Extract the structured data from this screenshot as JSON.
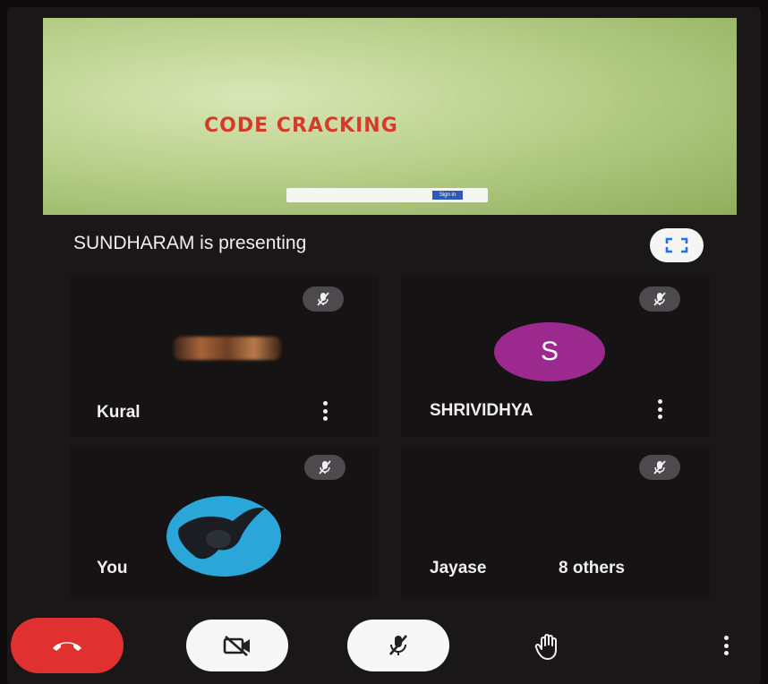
{
  "presentation": {
    "slide_title": "CODE CRACKING",
    "slide_button": "Sign in"
  },
  "presenting_label": "SUNDHARAM is presenting",
  "participants": [
    {
      "name": "Kural",
      "mic": "muted"
    },
    {
      "name": "SHRIVIDHYA",
      "initial": "S",
      "mic": "muted"
    },
    {
      "name": "You",
      "mic": "muted"
    },
    {
      "name": "Jayase",
      "mic": "muted"
    }
  ],
  "others_label": "8 others",
  "colors": {
    "end_call": "#e0302f",
    "avatar_shrividhya": "#9c2a8e",
    "avatar_you": "#2aa6d8",
    "slide_title": "#d63b2a"
  },
  "icons": {
    "fullscreen": "fullscreen-icon",
    "mic_off": "mic-off-icon",
    "more": "more-vert-icon",
    "end_call": "phone-hangup-icon",
    "camera_off": "camera-off-icon",
    "raise_hand": "raise-hand-icon"
  }
}
